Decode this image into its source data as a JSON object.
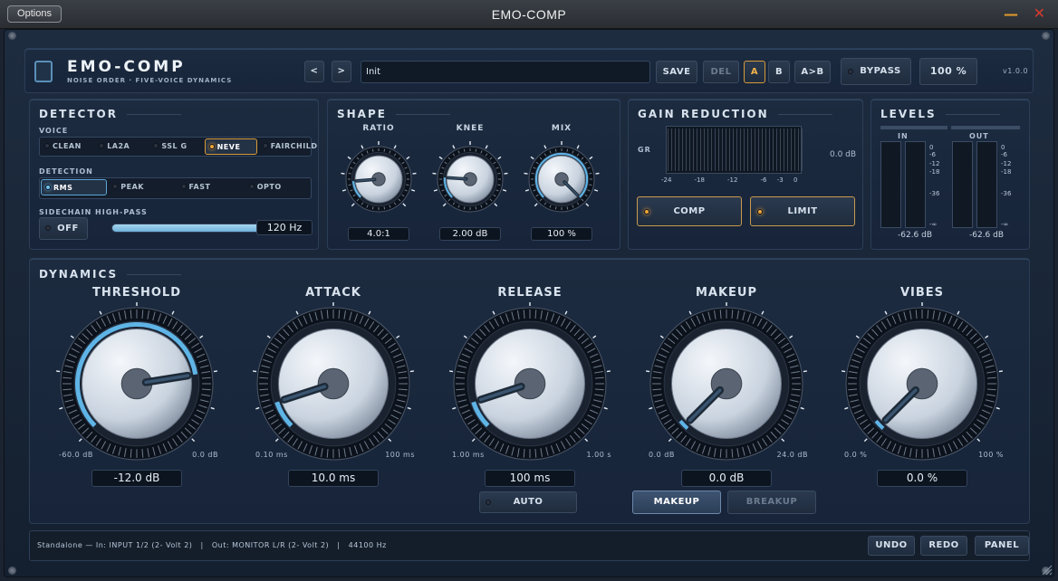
{
  "window": {
    "title": "EMO-COMP",
    "options_label": "Options",
    "minimize_glyph": "—",
    "close_glyph": "✕"
  },
  "header": {
    "brand": "EMO-COMP",
    "subtitle": "NOISE ORDER · FIVE-VOICE DYNAMICS",
    "prev_label": "<",
    "next_label": ">",
    "preset_name": "Init",
    "save_label": "SAVE",
    "del_label": "DEL",
    "a_label": "A",
    "b_label": "B",
    "ab_label": "A>B",
    "bypass_label": "BYPASS",
    "zoom_label": "100 %",
    "version": "v1.0.0"
  },
  "detector": {
    "title": "DETECTOR",
    "voice_label": "VOICE",
    "voices": [
      "CLEAN",
      "LA2A",
      "SSL G",
      "NEVE",
      "FAIRCHILD"
    ],
    "voice_selected": "NEVE",
    "detection_label": "DETECTION",
    "modes": [
      "RMS",
      "PEAK",
      "FAST",
      "OPTO"
    ],
    "mode_selected": "RMS",
    "sidechain_label": "SIDECHAIN HIGH-PASS",
    "sidechain_toggle": "OFF",
    "sidechain_value": "120 Hz",
    "sidechain_fraction": 0.78
  },
  "shape": {
    "title": "SHAPE",
    "knobs": [
      {
        "label": "RATIO",
        "value": "4.0:1",
        "fraction": 0.15
      },
      {
        "label": "KNEE",
        "value": "2.00 dB",
        "fraction": 0.18
      },
      {
        "label": "MIX",
        "value": "100 %",
        "fraction": 1.0
      }
    ]
  },
  "gain_reduction": {
    "title": "GAIN REDUCTION",
    "gr_label": "GR",
    "readout": "0.0 dB",
    "scale": [
      "-24",
      "-18",
      "-12",
      "-6",
      "-3",
      "0"
    ],
    "comp_label": "COMP",
    "limit_label": "LIMIT"
  },
  "levels": {
    "title": "LEVELS",
    "in_label": "IN",
    "out_label": "OUT",
    "scale": [
      "0",
      "-6",
      "-12",
      "-18",
      "-36",
      "-∞"
    ],
    "in_value": "-62.6 dB",
    "out_value": "-62.6 dB"
  },
  "dynamics": {
    "title": "DYNAMICS",
    "knobs": [
      {
        "label": "THRESHOLD",
        "min": "-60.0 dB",
        "max": "0.0 dB",
        "value": "-12.0 dB",
        "fraction": 0.8
      },
      {
        "label": "ATTACK",
        "min": "0.10 ms",
        "max": "100 ms",
        "value": "10.0 ms",
        "fraction": 0.1
      },
      {
        "label": "RELEASE",
        "min": "1.00 ms",
        "max": "1.00 s",
        "value": "100 ms",
        "fraction": 0.1
      },
      {
        "label": "MAKEUP",
        "min": "0.0 dB",
        "max": "24.0 dB",
        "value": "0.0 dB",
        "fraction": 0.0
      },
      {
        "label": "VIBES",
        "min": "0.0 %",
        "max": "100 %",
        "value": "0.0 %",
        "fraction": 0.0
      }
    ],
    "auto_label": "AUTO",
    "makeup_label": "MAKEUP",
    "breakup_label": "BREAKUP"
  },
  "status": {
    "text": "Standalone — In: INPUT 1/2 (2- Volt 2)   |   Out: MONITOR L/R (2- Volt 2)   |   44100 Hz",
    "undo_label": "UNDO",
    "redo_label": "REDO",
    "panel_label": "PANEL"
  },
  "colors": {
    "accent": "#f0a63a",
    "blue_arc": "#5fb4e6",
    "panel": "#1c2b3f"
  }
}
